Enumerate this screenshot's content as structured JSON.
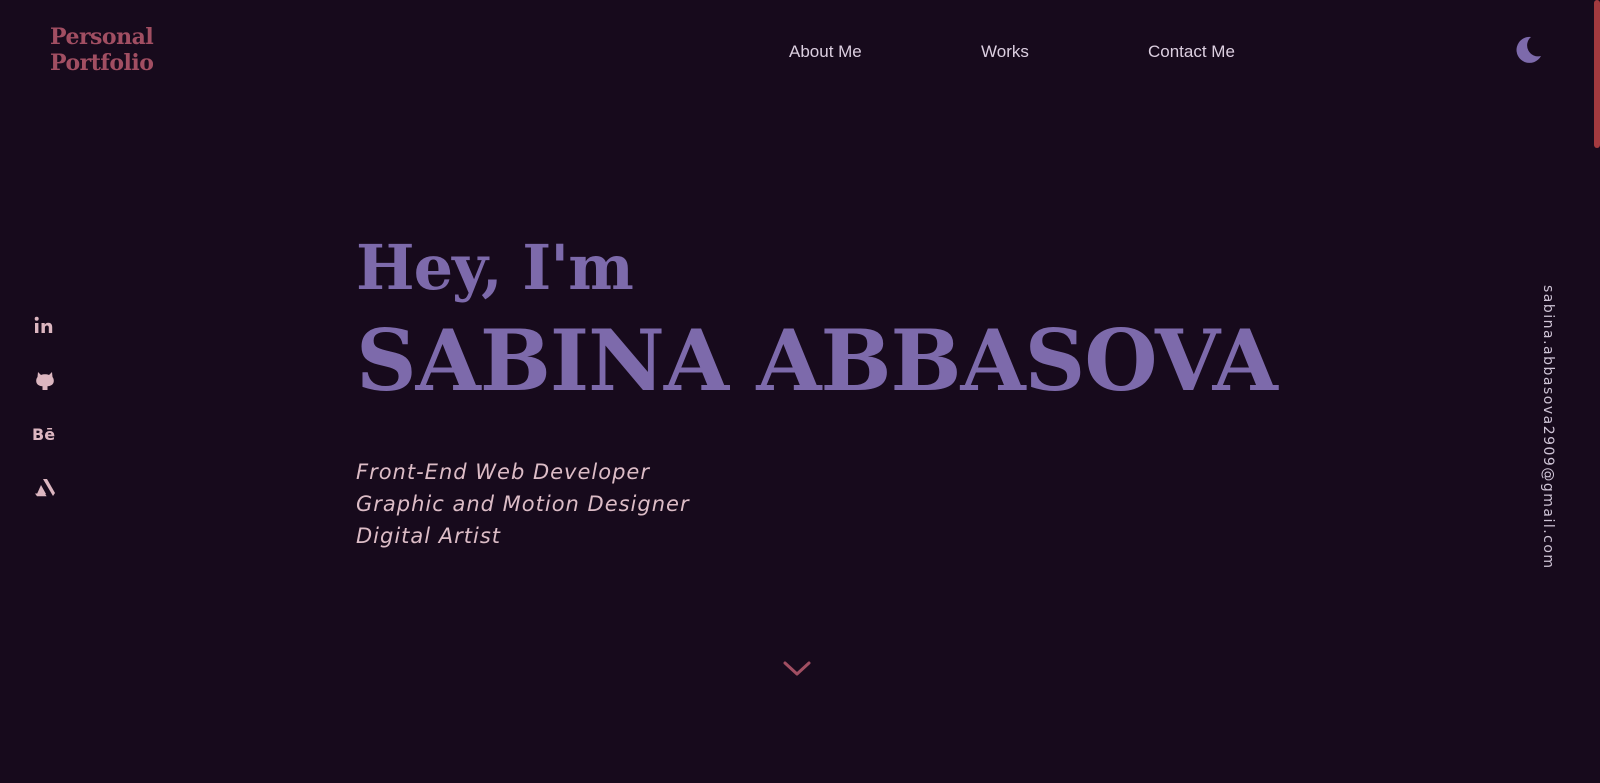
{
  "brand": {
    "line1": "Personal",
    "line2": "Portfolio",
    "color": "#a14e62"
  },
  "nav": {
    "items": [
      {
        "label": "About Me"
      },
      {
        "label": "Works"
      },
      {
        "label": "Contact Me"
      }
    ]
  },
  "theme_toggle": {
    "icon": "moon-icon"
  },
  "socials": [
    {
      "name": "linkedin",
      "icon": "linkedin-icon"
    },
    {
      "name": "github",
      "icon": "github-icon"
    },
    {
      "name": "behance",
      "icon": "behance-icon"
    },
    {
      "name": "artstation",
      "icon": "artstation-icon"
    }
  ],
  "hero": {
    "greeting": "Hey, I'm",
    "name": "SABINA ABBASOVA",
    "roles": [
      "Front-End Web Developer",
      "Graphic and Motion Designer",
      "Digital Artist"
    ]
  },
  "email": "sabina.abbasova2909@gmail.com",
  "scroll_down": {
    "icon": "chevron-down-icon"
  },
  "colors": {
    "background": "#170a1c",
    "accent": "#7d6aab",
    "brand": "#a14e62",
    "text": "#dcbcc6",
    "scrollbar": "#a33a3f"
  }
}
